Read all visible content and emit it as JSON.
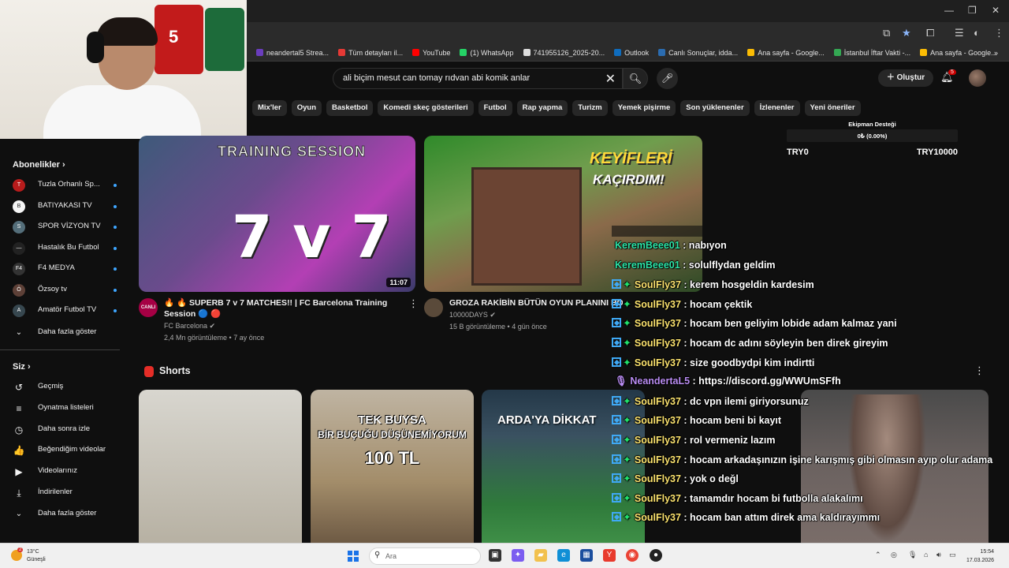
{
  "browser": {
    "bookmarks": [
      {
        "label": "neandertal5 Strea...",
        "color": "#6a3dbd"
      },
      {
        "label": "Tüm detayları il...",
        "color": "#e53935"
      },
      {
        "label": "YouTube",
        "color": "#ff0000"
      },
      {
        "label": "(1) WhatsApp",
        "color": "#25d366"
      },
      {
        "label": "741955126_2025-20...",
        "color": "#dddddd"
      },
      {
        "label": "Outlook",
        "color": "#0f6cbd"
      },
      {
        "label": "Canlı Sonuçlar, idda...",
        "color": "#2b6cb0"
      },
      {
        "label": "Ana sayfa - Google...",
        "color": "#fbbc04"
      },
      {
        "label": "İstanbul İftar Vakti -...",
        "color": "#34a853"
      },
      {
        "label": "Ana sayfa - Google...",
        "color": "#fbbc04"
      }
    ]
  },
  "header": {
    "search_query": "ali biçim mesut can tomay rıdvan abi komik anlar",
    "create_label": "Oluştur",
    "notification_count": "5"
  },
  "chips": [
    "Mix'ler",
    "Oyun",
    "Basketbol",
    "Komedi skeç gösterileri",
    "Futbol",
    "Rap yapma",
    "Turizm",
    "Yemek pişirme",
    "Son yüklenenler",
    "İzlenenler",
    "Yeni öneriler"
  ],
  "sidebar": {
    "subscriptions_title": "Abonelikler",
    "subscriptions": [
      {
        "label": "Tuzla Orhanlı Sp...",
        "color": "#b71c1c",
        "icon": "T"
      },
      {
        "label": "BATIYAKASI TV",
        "color": "#f5f5f5",
        "icon": "B"
      },
      {
        "label": "SPOR VİZYON TV",
        "color": "#546e7a",
        "icon": "S"
      },
      {
        "label": "Hastalık Bu Futbol",
        "color": "#222222",
        "icon": "—"
      },
      {
        "label": "F4 MEDYA",
        "color": "#333333",
        "icon": "F4"
      },
      {
        "label": "Özsoy tv",
        "color": "#5d4037",
        "icon": "Ö"
      },
      {
        "label": "Amatör Futbol TV",
        "color": "#37474f",
        "icon": "A"
      }
    ],
    "show_more": "Daha fazla göster",
    "you_title": "Siz",
    "you_items": [
      {
        "label": "Geçmiş",
        "icon": "history-icon",
        "glyph": "↺"
      },
      {
        "label": "Oynatma listeleri",
        "icon": "playlists-icon",
        "glyph": "≡"
      },
      {
        "label": "Daha sonra izle",
        "icon": "watch-later-icon",
        "glyph": "◷"
      },
      {
        "label": "Beğendiğim videolar",
        "icon": "like-icon",
        "glyph": "👍"
      },
      {
        "label": "Videolarınız",
        "icon": "your-videos-icon",
        "glyph": "▶"
      },
      {
        "label": "İndirilenler",
        "icon": "download-icon",
        "glyph": "⤓"
      }
    ],
    "show_more_2": "Daha fazla göster"
  },
  "videos": [
    {
      "thumb_text": "7 v 7",
      "thumb_banner": "TRAINING SESSION",
      "duration": "11:07",
      "channel_badge": "CANLI",
      "title": "🔥 🔥 SUPERB 7 v 7 MATCHES!! | FC Barcelona Training Session 🔵 🔴",
      "channel": "FC Barcelona ✔",
      "meta": "2,4 Mn görüntüleme • 7 ay önce"
    },
    {
      "thumb_text": "KEYİFLERİ",
      "thumb_text2": "KAÇIRDIM!",
      "title": "GROZA RAKİBİN BÜTÜN OYUN PLANINI BOZDU",
      "channel": "10000DAYS ✔",
      "meta": "15 B görüntüleme • 4 gün önce"
    }
  ],
  "shorts": {
    "title": "Shorts",
    "items": [
      {
        "caption": ""
      },
      {
        "caption_1": "TEK BUYSA",
        "caption_2": "BİR BUÇUĞU DÜŞÜNEMİYORUM",
        "caption_3": "100 TL"
      },
      {
        "caption": "ARDA'YA DİKKAT"
      }
    ]
  },
  "goal": {
    "title": "Ekipman Desteği",
    "percent_text": "0₺ (0.00%)",
    "progress": 0,
    "min": "TRY0",
    "max": "TRY10000"
  },
  "chat": [
    {
      "user": "KeremBeee01",
      "text": " : nabıyon",
      "color": "#2ee6a8",
      "badges": false
    },
    {
      "user": "KeremBeee01",
      "text": " : solulflydan geldim",
      "color": "#2ee6a8",
      "badges": false
    },
    {
      "user": "SoulFly37",
      "text": " : kerem hosgeldin kardesim",
      "color": "#fbe26e",
      "badges": true
    },
    {
      "user": "SoulFly37",
      "text": " : hocam çektik",
      "color": "#fbe26e",
      "badges": true
    },
    {
      "user": "SoulFly37",
      "text": " : hocam ben geliyim lobide adam kalmaz yani",
      "color": "#fbe26e",
      "badges": true
    },
    {
      "user": "SoulFly37",
      "text": " : hocam dc adını söyleyin ben direk gireyim",
      "color": "#fbe26e",
      "badges": true
    },
    {
      "user": "SoulFly37",
      "text": " : size goodbydpi kim indirtti",
      "color": "#fbe26e",
      "badges": true
    },
    {
      "user": "NeandertaL5",
      "text": " : https://discord.gg/WWUmSFfh",
      "color": "#b98cf2",
      "badges": false,
      "mic": true
    },
    {
      "user": "SoulFly37",
      "text": " : dc vpn ilemi giriyorsunuz",
      "color": "#fbe26e",
      "badges": true
    },
    {
      "user": "SoulFly37",
      "text": " : hocam beni bi kayıt",
      "color": "#fbe26e",
      "badges": true
    },
    {
      "user": "SoulFly37",
      "text": " : rol vermeniz lazım",
      "color": "#fbe26e",
      "badges": true
    },
    {
      "user": "SoulFly37",
      "text": " : hocam arkadaşınızın işine karışmış gibi olmasın ayıp olur adama",
      "color": "#fbe26e",
      "badges": true
    },
    {
      "user": "SoulFly37",
      "text": " : yok o değl",
      "color": "#fbe26e",
      "badges": true
    },
    {
      "user": "SoulFly37",
      "text": " : tamamdır hocam bi futbolla alakalımı",
      "color": "#fbe26e",
      "badges": true
    },
    {
      "user": "SoulFly37",
      "text": " : hocam ban attım direk ama kaldırayımmı",
      "color": "#fbe26e",
      "badges": true
    }
  ],
  "taskbar": {
    "weather_temp": "13°C",
    "weather_desc": "Güneşli",
    "weather_badge": "2",
    "search_placeholder": "Ara",
    "time": "15:54",
    "date": "17.03.2026"
  },
  "colors": {
    "background": "#0f0f0f",
    "accent_red": "#ff0000",
    "link_blue": "#3ea6ff"
  }
}
